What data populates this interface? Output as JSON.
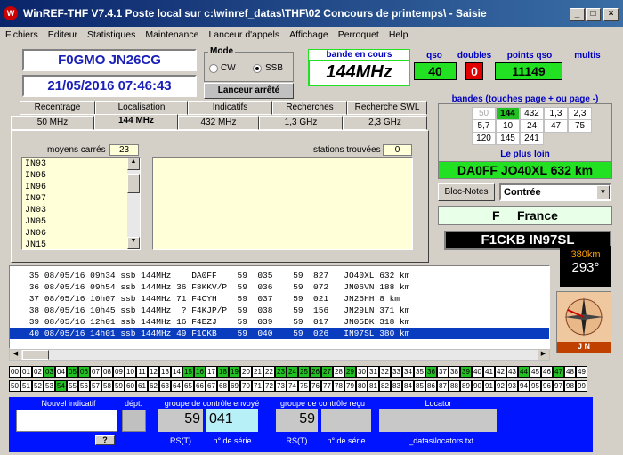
{
  "window": {
    "title": "WinREF-THF V7.4.1 Poste local sur c:\\winref_datas\\THF\\02 Concours de printemps\\ -   Saisie",
    "min": "_",
    "max": "□",
    "close": "×"
  },
  "menu": [
    "Fichiers",
    "Editeur",
    "Statistiques",
    "Maintenance",
    "Lanceur d'appels",
    "Affichage",
    "Perroquet",
    "Help"
  ],
  "station": {
    "call_loc": "F0GMO  JN26CG",
    "datetime": "21/05/2016  07:46:43"
  },
  "mode": {
    "label": "Mode",
    "cw": "CW",
    "ssb": "SSB",
    "selected": "SSB"
  },
  "launcher": "Lanceur arrêté",
  "band": {
    "label": "bande en cours",
    "value": "144MHz"
  },
  "stats": {
    "qso_label": "qso",
    "qso": "40",
    "doubles_label": "doubles",
    "doubles": "0",
    "points_label": "points qso",
    "points": "11149",
    "multis_label": "multis"
  },
  "tabs_top": [
    "Recentrage",
    "Localisation",
    "Indicatifs",
    "Recherches",
    "Recherche SWL"
  ],
  "tabs_bands": [
    "50 MHz",
    "144 MHz",
    "432 MHz",
    "1,3 GHz",
    "2,3 GHz"
  ],
  "squares": {
    "label": "moyens carrés :",
    "count": "23",
    "items": [
      "IN93",
      "IN95",
      "IN96",
      "IN97",
      "JN03",
      "JN05",
      "JN06",
      "JN15"
    ]
  },
  "found": {
    "label": "stations trouvées :",
    "count": "0"
  },
  "bands_panel": {
    "label": "bandes (touches page + ou page -)",
    "cells": [
      "50",
      "144",
      "432",
      "1,3",
      "2,3",
      "5,7",
      "10",
      "24",
      "47",
      "75",
      "120",
      "145",
      "241"
    ],
    "active": "144",
    "disabled": "50"
  },
  "farthest": {
    "label": "Le plus loin",
    "value": "DA0FF JO40XL  632 km"
  },
  "notes_btn": "Bloc-Notes",
  "contree": "Contrée",
  "country": {
    "prefix": "F",
    "name": "France"
  },
  "last": {
    "call": "F1CKB   IN97SL",
    "dist": "380km",
    "az": "293°"
  },
  "compass_label": "J N",
  "log": [
    {
      "n": "35",
      "date": "08/05/16",
      "time": "09h34",
      "mode": "ssb",
      "band": "144MHz",
      "pts": "",
      "call": "DA0FF",
      "rs": "59",
      "sent": "035",
      "rr": "59",
      "rcv": "827",
      "loc": "JO40XL",
      "km": "632 km"
    },
    {
      "n": "36",
      "date": "08/05/16",
      "time": "09h54",
      "mode": "ssb",
      "band": "144MHz",
      "pts": "36",
      "call": "F8KKV/P",
      "rs": "59",
      "sent": "036",
      "rr": "59",
      "rcv": "072",
      "loc": "JN06VN",
      "km": "188 km"
    },
    {
      "n": "37",
      "date": "08/05/16",
      "time": "10h07",
      "mode": "ssb",
      "band": "144MHz",
      "pts": "71",
      "call": "F4CYH",
      "rs": "59",
      "sent": "037",
      "rr": "59",
      "rcv": "021",
      "loc": "JN26HH",
      "km": "8 km"
    },
    {
      "n": "38",
      "date": "08/05/16",
      "time": "10h45",
      "mode": "ssb",
      "band": "144MHz",
      "pts": "?",
      "call": "F4KJP/P",
      "rs": "59",
      "sent": "038",
      "rr": "59",
      "rcv": "156",
      "loc": "JN29LN",
      "km": "371 km"
    },
    {
      "n": "39",
      "date": "08/05/16",
      "time": "12h01",
      "mode": "ssb",
      "band": "144MHz",
      "pts": "16",
      "call": "F4EZJ",
      "rs": "59",
      "sent": "039",
      "rr": "59",
      "rcv": "017",
      "loc": "JN05DK",
      "km": "318 km"
    },
    {
      "n": "40",
      "date": "08/05/16",
      "time": "14h01",
      "mode": "ssb",
      "band": "144MHz",
      "pts": "49",
      "call": "F1CKB",
      "rs": "59",
      "sent": "040",
      "rr": "59",
      "rcv": "026",
      "loc": "IN97SL",
      "km": "380 km"
    }
  ],
  "num_row1": [
    "00",
    "01",
    "02",
    "03",
    "04",
    "05",
    "06",
    "07",
    "08",
    "09",
    "10",
    "11",
    "12",
    "13",
    "14",
    "15",
    "16",
    "17",
    "18",
    "19",
    "20",
    "21",
    "22",
    "23",
    "24",
    "25",
    "26",
    "27",
    "28",
    "29",
    "30",
    "31",
    "32",
    "33",
    "34",
    "35",
    "36",
    "37",
    "38",
    "39",
    "40",
    "41",
    "42",
    "43",
    "44",
    "45",
    "46",
    "47",
    "48",
    "49"
  ],
  "num_row2": [
    "50",
    "51",
    "52",
    "53",
    "54",
    "55",
    "56",
    "57",
    "58",
    "59",
    "60",
    "61",
    "62",
    "63",
    "64",
    "65",
    "66",
    "67",
    "68",
    "69",
    "70",
    "71",
    "72",
    "73",
    "74",
    "75",
    "76",
    "77",
    "78",
    "79",
    "80",
    "81",
    "82",
    "83",
    "84",
    "85",
    "86",
    "87",
    "88",
    "89",
    "90",
    "91",
    "92",
    "93",
    "94",
    "95",
    "96",
    "97",
    "98",
    "99"
  ],
  "green1": [
    "03",
    "05",
    "06",
    "15",
    "16",
    "18",
    "19",
    "23",
    "24",
    "25",
    "26",
    "27",
    "29",
    "36",
    "39",
    "44",
    "47"
  ],
  "green2": [
    "54"
  ],
  "colors": {
    "accent_green": "#22e022",
    "selection": "#0a3cc0",
    "bottom_panel": "#0014ff"
  },
  "bottom": {
    "new_call": "Nouvel indicatif",
    "dept": "dépt.",
    "q": "?",
    "sent_label": "groupe de contrôle envoyé",
    "sent_rs": "59",
    "sent_serial": "041",
    "rs_label": "RS(T)",
    "serial_label": "n° de série",
    "rcv_label": "groupe de contrôle reçu",
    "rcv_rs": "59",
    "rcv_rs_label": "RS(T)",
    "rcv_serial_label": "n° de série",
    "locator": "Locator",
    "file": "..._datas\\locators.txt"
  }
}
